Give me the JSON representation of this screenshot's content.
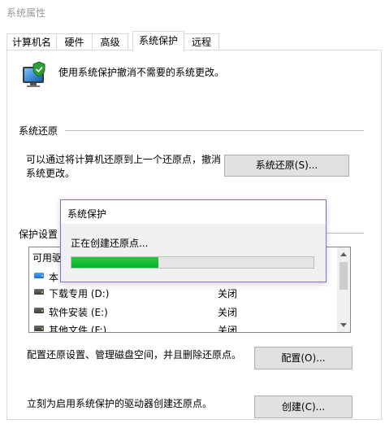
{
  "window": {
    "title": "系统属性"
  },
  "tabs": [
    {
      "label": "计算机名"
    },
    {
      "label": "硬件"
    },
    {
      "label": "高级"
    },
    {
      "label": "系统保护",
      "active": true
    },
    {
      "label": "远程"
    }
  ],
  "intro": {
    "text": "使用系统保护撤消不需要的系统更改。",
    "icon": "computer-shield-icon"
  },
  "restore": {
    "section_label": "系统还原",
    "description_line1": "可以通过将计算机还原到上一个还原点，撤消",
    "description_line2": "系统更改。",
    "button_label": "系统还原(S)..."
  },
  "protection": {
    "section_label": "保护设置",
    "list_header": "可用驱",
    "drives": [
      {
        "name": "本",
        "status": ""
      },
      {
        "name": "下载专用 (D:)",
        "status": "关闭"
      },
      {
        "name": "软件安装 (E:)",
        "status": "关闭"
      },
      {
        "name": "其他文件 (F:)",
        "status": "关闭"
      }
    ]
  },
  "configure": {
    "description": "配置还原设置、管理磁盘空间，并且删除还原点。",
    "button_label": "配置(O)..."
  },
  "create": {
    "description": "立刻为启用系统保护的驱动器创建还原点。",
    "button_label": "创建(C)..."
  },
  "progress_dialog": {
    "title": "系统保护",
    "status": "正在创建还原点...",
    "progress_fraction": 0.36,
    "progress_color": "#06b025"
  }
}
